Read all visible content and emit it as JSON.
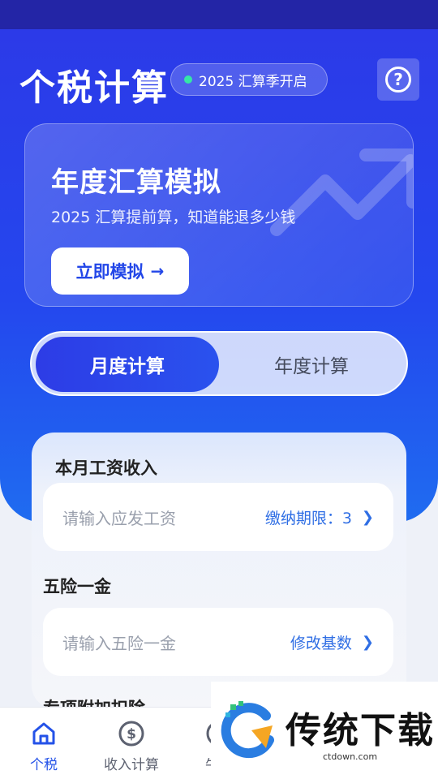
{
  "header": {
    "title": "个税计算",
    "season_badge": "2025 汇算季开启",
    "help_icon": "question-circle-icon"
  },
  "promo": {
    "title": "年度汇算模拟",
    "subtitle": "2025 汇算提前算，知道能退多少钱",
    "button_label": "立即模拟",
    "button_icon": "arrow-right-icon",
    "decoration_icon": "trend-up-arrow-icon"
  },
  "segment": {
    "tabs": [
      {
        "label": "月度计算",
        "active": true
      },
      {
        "label": "年度计算",
        "active": false
      }
    ]
  },
  "form": {
    "salary": {
      "label": "本月工资收入",
      "placeholder": "请输入应发工资",
      "link": "缴纳期限：3"
    },
    "insurance": {
      "label": "五险一金",
      "placeholder": "请输入五险一金",
      "link": "修改基数"
    },
    "deduction": {
      "label": "专项附加扣除"
    }
  },
  "tabbar": {
    "items": [
      {
        "label": "个税",
        "icon": "home-icon",
        "active": true
      },
      {
        "label": "收入计算",
        "icon": "dollar-circle-icon",
        "active": false
      },
      {
        "label": "牛马",
        "icon": "circle-icon",
        "active": false
      }
    ]
  },
  "watermark": {
    "brand": "传统下载",
    "url": "ctdown.com"
  },
  "colors": {
    "primary": "#2447ee",
    "accent_text": "#2f6ee4",
    "status_dot": "#35e6a6"
  }
}
